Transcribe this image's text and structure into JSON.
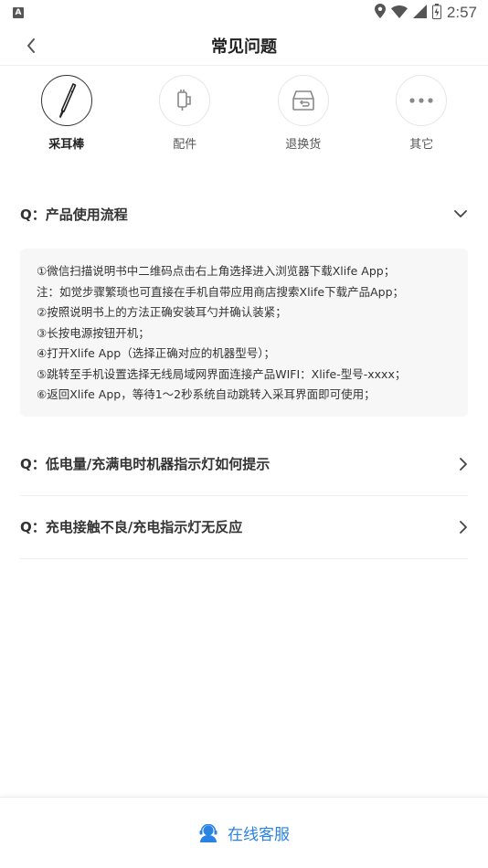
{
  "status_bar": {
    "app_letter": "A",
    "time": "2:57"
  },
  "header": {
    "title": "常见问题"
  },
  "categories": [
    {
      "label": "采耳棒",
      "icon": "ear-pick-icon",
      "active": true
    },
    {
      "label": "配件",
      "icon": "accessory-icon",
      "active": false
    },
    {
      "label": "退换货",
      "icon": "return-box-icon",
      "active": false
    },
    {
      "label": "其它",
      "icon": "more-dots-icon",
      "active": false
    }
  ],
  "faq": [
    {
      "question": "Q：产品使用流程",
      "expanded": true,
      "answer_lines": [
        "①微信扫描说明书中二维码点击右上角选择进入浏览器下载Xlife App；",
        "注：如觉步骤繁琐也可直接在手机自带应用商店搜索Xlife下载产品App；",
        "②按照说明书上的方法正确安装耳勺并确认装紧；",
        "③长按电源按钮开机；",
        "④打开Xlife App（选择正确对应的机器型号）；",
        "⑤跳转至手机设置选择无线局域网界面连接产品WIFI：Xlife-型号-xxxx；",
        "⑥返回Xlife App，等待1～2秒系统自动跳转入采耳界面即可使用；"
      ]
    },
    {
      "question": "Q：低电量/充满电时机器指示灯如何提示",
      "expanded": false
    },
    {
      "question": "Q：充电接触不良/充电指示灯无反应",
      "expanded": false
    }
  ],
  "bottom": {
    "service_label": "在线客服"
  },
  "colors": {
    "accent": "#2a82e4",
    "text": "#333333",
    "answer_bg": "#f7f7f7"
  }
}
